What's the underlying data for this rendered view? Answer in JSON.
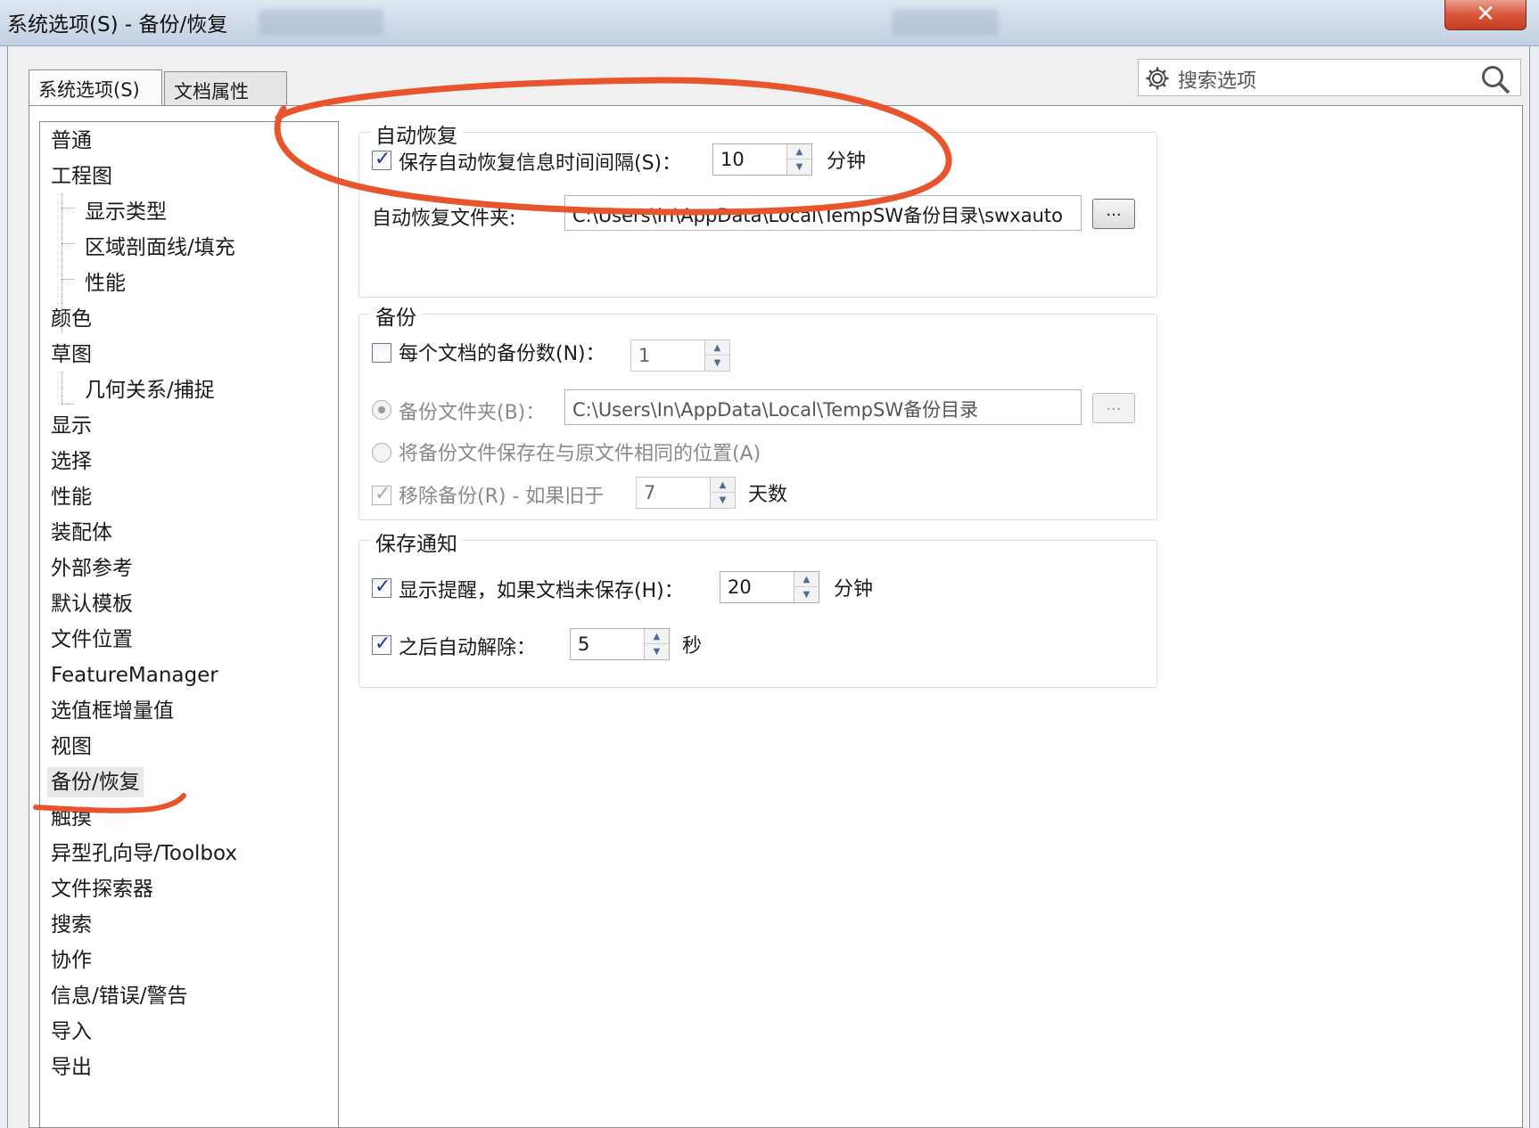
{
  "window": {
    "title": "系统选项(S) - 备份/恢复",
    "close_label": "✕"
  },
  "tabs": [
    {
      "label": "系统选项(S)",
      "active": true
    },
    {
      "label": "文档属性(D)",
      "active": false
    }
  ],
  "search": {
    "placeholder": "搜索选项",
    "icon": "search-icon",
    "settings_icon": "gear-icon"
  },
  "tree": {
    "items": [
      {
        "label": "普通",
        "level": 0
      },
      {
        "label": "工程图",
        "level": 0
      },
      {
        "label": "显示类型",
        "level": 1
      },
      {
        "label": "区域剖面线/填充",
        "level": 1
      },
      {
        "label": "性能",
        "level": 1
      },
      {
        "label": "颜色",
        "level": 0
      },
      {
        "label": "草图",
        "level": 0
      },
      {
        "label": "几何关系/捕捉",
        "level": 1
      },
      {
        "label": "显示",
        "level": 0
      },
      {
        "label": "选择",
        "level": 0
      },
      {
        "label": "性能",
        "level": 0
      },
      {
        "label": "装配体",
        "level": 0
      },
      {
        "label": "外部参考",
        "level": 0
      },
      {
        "label": "默认模板",
        "level": 0
      },
      {
        "label": "文件位置",
        "level": 0
      },
      {
        "label": "FeatureManager",
        "level": 0
      },
      {
        "label": "选值框增量值",
        "level": 0
      },
      {
        "label": "视图",
        "level": 0
      },
      {
        "label": "备份/恢复",
        "level": 0,
        "selected": true
      },
      {
        "label": "触摸",
        "level": 0
      },
      {
        "label": "异型孔向导/Toolbox",
        "level": 0
      },
      {
        "label": "文件探索器",
        "level": 0
      },
      {
        "label": "搜索",
        "level": 0
      },
      {
        "label": "协作",
        "level": 0
      },
      {
        "label": "信息/错误/警告",
        "level": 0
      },
      {
        "label": "导入",
        "level": 0
      },
      {
        "label": "导出",
        "level": 0
      }
    ]
  },
  "autorecover": {
    "group_title": "自动恢复",
    "save_interval_label": "保存自动恢复信息时间间隔(S)：",
    "save_interval_checked": true,
    "save_interval_value": "10",
    "save_interval_unit": "分钟",
    "folder_label": "自动恢复文件夹:",
    "folder_value": "C:\\Users\\In\\AppData\\Local\\TempSW备份目录\\swxauto",
    "browse_label": "..."
  },
  "backup": {
    "group_title": "备份",
    "copies_label": "每个文档的备份数(N)：",
    "copies_checked": false,
    "copies_value": "1",
    "folder_label": "备份文件夹(B)：",
    "folder_selected": true,
    "folder_value": "C:\\Users\\In\\AppData\\Local\\TempSW备份目录",
    "browse_label": "...",
    "same_location_label": "将备份文件保存在与原文件相同的位置(A)",
    "same_location_selected": false,
    "remove_label": "移除备份(R) - 如果旧于",
    "remove_checked": true,
    "remove_value": "7",
    "remove_unit": "天数"
  },
  "save_notification": {
    "group_title": "保存通知",
    "reminder_label": "显示提醒，如果文档未保存(H)：",
    "reminder_checked": true,
    "reminder_value": "20",
    "reminder_unit": "分钟",
    "dismiss_label": "之后自动解除：",
    "dismiss_checked": true,
    "dismiss_value": "5",
    "dismiss_unit": "秒"
  },
  "colors": {
    "annotation": "#e8542b",
    "checkmark": "#1e3d8f",
    "titlebar": "#cfdae9",
    "close_button": "#d8553a"
  }
}
